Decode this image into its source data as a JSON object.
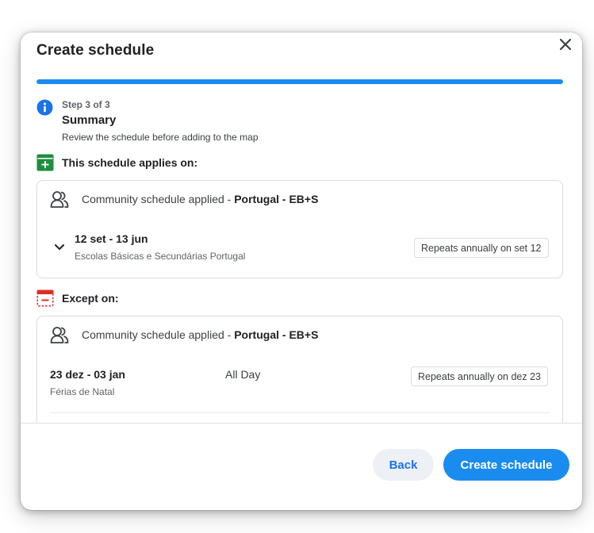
{
  "dialog": {
    "title": "Create schedule",
    "progress_fraction": 1.0
  },
  "step": {
    "label": "Step 3 of 3",
    "title": "Summary",
    "description": "Review the schedule before adding to the map"
  },
  "applies": {
    "header": "This schedule applies on:",
    "community_prefix": "Community schedule applied - ",
    "community_name": "Portugal - EB+S",
    "range_title": "12 set - 13 jun",
    "range_subtitle": "Escolas Básicas e Secundárias Portugal",
    "repeat_chip": "Repeats annually on set 12"
  },
  "except": {
    "header": "Except on:",
    "community_prefix": "Community schedule applied - ",
    "community_name": "Portugal - EB+S",
    "range_title": "23 dez - 03 jan",
    "time_label": "All Day",
    "range_subtitle": "Férias de Natal",
    "repeat_chip": "Repeats annually on dez 23"
  },
  "footer": {
    "back_label": "Back",
    "create_label": "Create schedule"
  },
  "colors": {
    "accent": "#1a8cf0",
    "applies_icon": "#1e8e3e",
    "except_icon": "#d93025"
  },
  "icons": {
    "close": "close-icon",
    "info": "info-icon",
    "applies": "calendar-plus-icon",
    "except": "calendar-minus-icon",
    "community": "community-icon",
    "expand": "chevron-down-icon"
  }
}
